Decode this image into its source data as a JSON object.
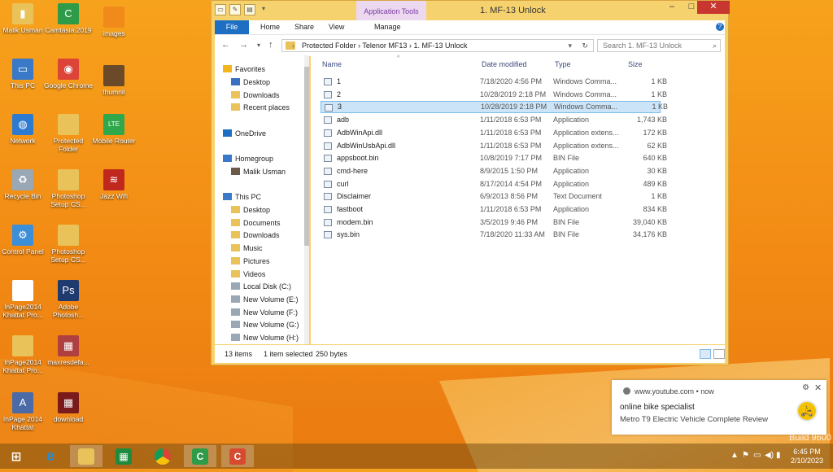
{
  "desktop": {
    "watermark": "Build 9600",
    "icons": [
      {
        "label": "Malik Usman",
        "icon": "user-folder-icon",
        "color": "#e9c25a"
      },
      {
        "label": "Camtasia 2019",
        "icon": "camtasia-icon",
        "color": "#2e9b48"
      },
      {
        "label": "images",
        "icon": "folder-icon",
        "color": "#f08a1a"
      },
      {
        "label": "This PC",
        "icon": "computer-icon",
        "color": "#3a78c8"
      },
      {
        "label": "Google Chrome",
        "icon": "chrome-icon",
        "color": "#db4437"
      },
      {
        "label": "thumnil",
        "icon": "folder-icon",
        "color": "#6b4a2a"
      },
      {
        "label": "Network",
        "icon": "network-icon",
        "color": "#2d7bd0"
      },
      {
        "label": "Protected Folder",
        "icon": "folder-icon",
        "color": "#e9c25a"
      },
      {
        "label": "Mobile Router",
        "icon": "lte-icon",
        "color": "#2ea84a"
      },
      {
        "label": "Recycle Bin",
        "icon": "recycle-bin-icon",
        "color": "#9aa7b4"
      },
      {
        "label": "Photoshop Setup CS...",
        "icon": "folder-icon",
        "color": "#e9c25a"
      },
      {
        "label": "Jazz Wifi",
        "icon": "jazz-wifi-icon",
        "color": "#c0281e"
      },
      {
        "label": "Control Panel",
        "icon": "control-panel-icon",
        "color": "#3b8ed8"
      },
      {
        "label": "Photoshop Setup CS...",
        "icon": "folder-icon",
        "color": "#e9c25a"
      },
      {
        "label": "InPage2014 Khattat Pro...",
        "icon": "document-icon",
        "color": "#ffffff"
      },
      {
        "label": "Adobe Photosh...",
        "icon": "photoshop-icon",
        "color": "#1e3a6e"
      },
      {
        "label": "InPage2014 Khattat Pro...",
        "icon": "folder-icon",
        "color": "#e9c25a"
      },
      {
        "label": "maxresdefa...",
        "icon": "image-icon",
        "color": "#b04040"
      },
      {
        "label": "InPage 2014 Khattat",
        "icon": "inpage-icon",
        "color": "#4a6aa8"
      },
      {
        "label": "download",
        "icon": "image-icon",
        "color": "#7a1a1a"
      }
    ]
  },
  "explorer": {
    "title": "1. MF-13 Unlock",
    "app_tools": "Application Tools",
    "ribbon_tabs": [
      "File",
      "Home",
      "Share",
      "View",
      "Manage"
    ],
    "breadcrumb": [
      "Protected Folder",
      "Telenor MF13",
      "1. MF-13 Unlock"
    ],
    "search_placeholder": "Search 1. MF-13 Unlock",
    "nav": {
      "favorites": "Favorites",
      "favorites_items": [
        "Desktop",
        "Downloads",
        "Recent places"
      ],
      "onedrive": "OneDrive",
      "homegroup": "Homegroup",
      "homegroup_items": [
        "Malik Usman"
      ],
      "thispc": "This PC",
      "thispc_items": [
        "Desktop",
        "Documents",
        "Downloads",
        "Music",
        "Pictures",
        "Videos",
        "Local Disk (C:)",
        "New Volume (E:)",
        "New Volume (F:)",
        "New Volume (G:)",
        "New Volume (H:)"
      ]
    },
    "columns": {
      "name": "Name",
      "date": "Date modified",
      "type": "Type",
      "size": "Size"
    },
    "files": [
      {
        "name": "1",
        "date": "7/18/2020 4:56 PM",
        "type": "Windows Comma...",
        "size": "1 KB"
      },
      {
        "name": "2",
        "date": "10/28/2019 2:18 PM",
        "type": "Windows Comma...",
        "size": "1 KB"
      },
      {
        "name": "3",
        "date": "10/28/2019 2:18 PM",
        "type": "Windows Comma...",
        "size": "1 KB"
      },
      {
        "name": "adb",
        "date": "1/11/2018 6:53 PM",
        "type": "Application",
        "size": "1,743 KB"
      },
      {
        "name": "AdbWinApi.dll",
        "date": "1/11/2018 6:53 PM",
        "type": "Application extens...",
        "size": "172 KB"
      },
      {
        "name": "AdbWinUsbApi.dll",
        "date": "1/11/2018 6:53 PM",
        "type": "Application extens...",
        "size": "62 KB"
      },
      {
        "name": "appsboot.bin",
        "date": "10/8/2019 7:17 PM",
        "type": "BIN File",
        "size": "640 KB"
      },
      {
        "name": "cmd-here",
        "date": "8/9/2015 1:50 PM",
        "type": "Application",
        "size": "30 KB"
      },
      {
        "name": "curl",
        "date": "8/17/2014 4:54 PM",
        "type": "Application",
        "size": "489 KB"
      },
      {
        "name": "Disclaimer",
        "date": "6/9/2013 8:56 PM",
        "type": "Text Document",
        "size": "1 KB"
      },
      {
        "name": "fastboot",
        "date": "1/11/2018 6:53 PM",
        "type": "Application",
        "size": "834 KB"
      },
      {
        "name": "modem.bin",
        "date": "3/5/2019 9:46 PM",
        "type": "BIN File",
        "size": "39,040 KB"
      },
      {
        "name": "sys.bin",
        "date": "7/18/2020 11:33 AM",
        "type": "BIN File",
        "size": "34,176 KB"
      }
    ],
    "selected_index": 2,
    "status": {
      "items": "13 items",
      "selected": "1 item selected",
      "bytes": "250 bytes"
    }
  },
  "toast": {
    "source": "www.youtube.com",
    "dot": "•",
    "time": "now",
    "title": "online bike specialist",
    "body": "Metro T9 Electric Vehicle Complete Review"
  },
  "clock": {
    "time": "6:45 PM",
    "date": "2/10/2023"
  },
  "taskbar_apps": [
    {
      "name": "start-button",
      "color": "#ffffff"
    },
    {
      "name": "internet-explorer-icon",
      "color": "#1e8fe0"
    },
    {
      "name": "file-explorer-icon",
      "color": "#e9c25a"
    },
    {
      "name": "spreadsheet-app-icon",
      "color": "#1e8a3e"
    },
    {
      "name": "chrome-icon",
      "color": "#db4437"
    },
    {
      "name": "camtasia-icon",
      "color": "#2e9b48"
    },
    {
      "name": "camtasia-recorder-icon",
      "color": "#d84a30"
    }
  ]
}
